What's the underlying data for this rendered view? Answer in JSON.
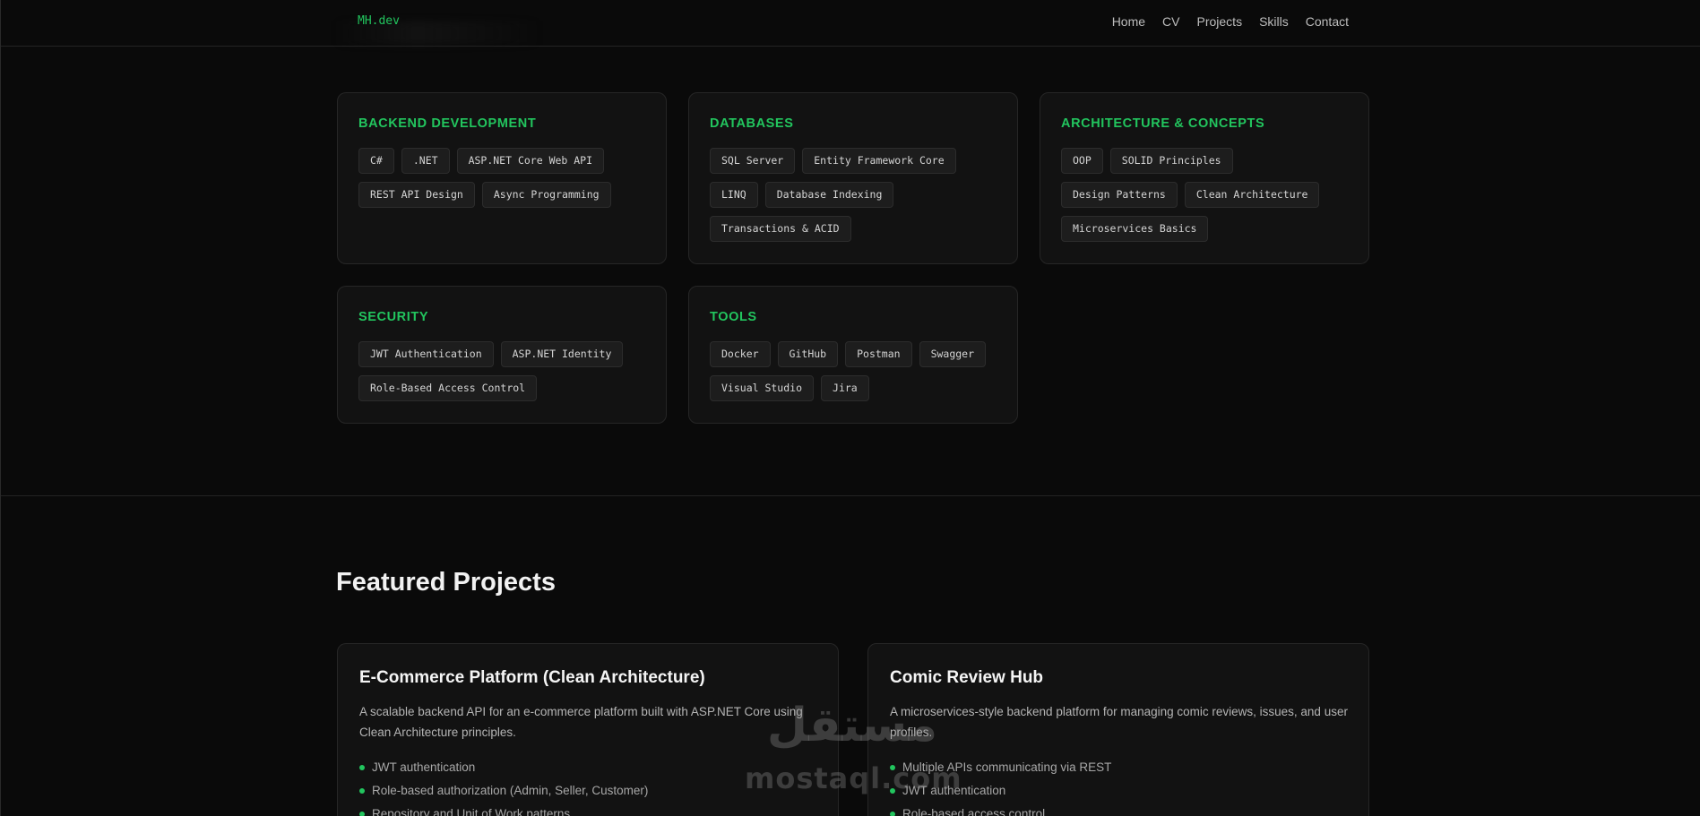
{
  "header": {
    "logo": "MH.dev",
    "nav": [
      "Home",
      "CV",
      "Projects",
      "Skills",
      "Contact"
    ]
  },
  "skills": {
    "backend": {
      "title": "BACKEND DEVELOPMENT",
      "items": [
        "C#",
        ".NET",
        "ASP.NET Core Web API",
        "REST API Design",
        "Async Programming"
      ]
    },
    "databases": {
      "title": "DATABASES",
      "items": [
        "SQL Server",
        "Entity Framework Core",
        "LINQ",
        "Database Indexing",
        "Transactions & ACID"
      ]
    },
    "architecture": {
      "title": "ARCHITECTURE & CONCEPTS",
      "items": [
        "OOP",
        "SOLID Principles",
        "Design Patterns",
        "Clean Architecture",
        "Microservices Basics"
      ]
    },
    "security": {
      "title": "SECURITY",
      "items": [
        "JWT Authentication",
        "ASP.NET Identity",
        "Role-Based Access Control"
      ]
    },
    "tools": {
      "title": "TOOLS",
      "items": [
        "Docker",
        "GitHub",
        "Postman",
        "Swagger",
        "Visual Studio",
        "Jira"
      ]
    }
  },
  "projects_section": {
    "title": "Featured Projects",
    "items": [
      {
        "title": "E-Commerce Platform (Clean Architecture)",
        "description": "A scalable backend API for an e-commerce platform built with ASP.NET Core using Clean Architecture principles.",
        "features": [
          "JWT authentication",
          "Role-based authorization (Admin, Seller, Customer)",
          "Repository and Unit of Work patterns"
        ]
      },
      {
        "title": "Comic Review Hub",
        "description": "A microservices-style backend platform for managing comic reviews, issues, and user profiles.",
        "features": [
          "Multiple APIs communicating via REST",
          "JWT authentication",
          "Role-based access control"
        ]
      }
    ]
  },
  "watermark": {
    "arabic": "مستقل",
    "latin": "mostaql.com"
  },
  "colors": {
    "accent": "#22c55e",
    "background": "#0a0a0a",
    "card": "#121212"
  }
}
